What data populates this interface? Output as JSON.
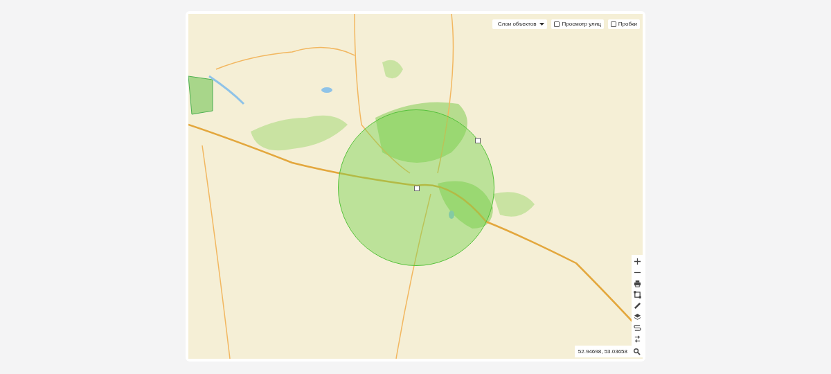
{
  "map": {
    "layers_dropdown": {
      "label": "Слои объектов"
    },
    "toggles": [
      {
        "label": "Просмотр улиц",
        "checked": false
      },
      {
        "label": "Пробки",
        "checked": false
      }
    ],
    "coordinates": "52.94698, 53.03658"
  }
}
